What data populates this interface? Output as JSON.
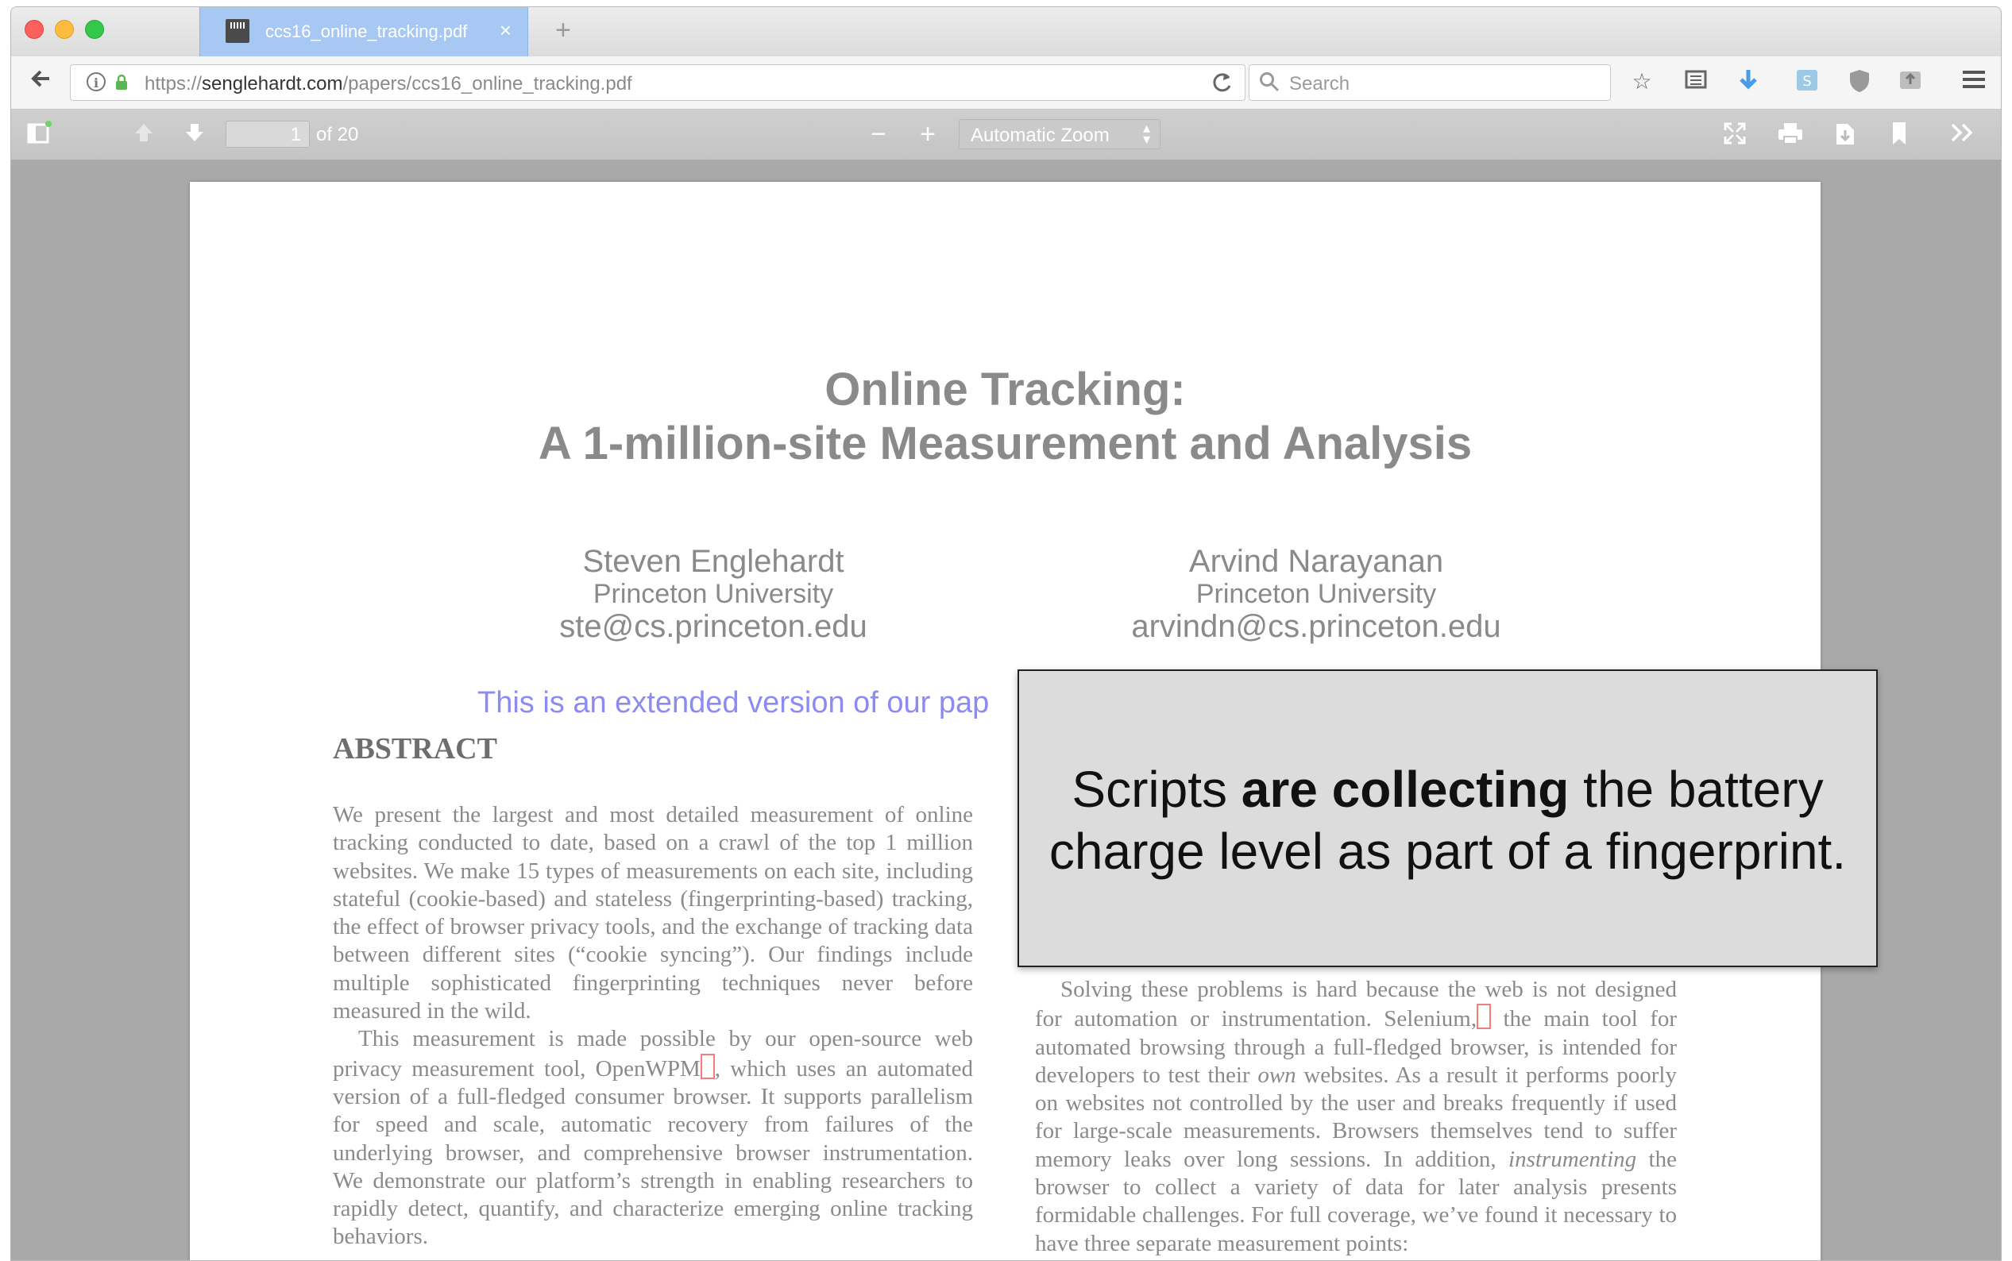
{
  "browser": {
    "tab_title": "ccs16_online_tracking.pdf",
    "tab_close": "×",
    "new_tab": "+",
    "url_scheme": "https://",
    "url_host": "senglehardt.com",
    "url_path": "/papers/ccs16_online_tracking.pdf",
    "search_placeholder": "Search"
  },
  "pdf_toolbar": {
    "page_number": "1",
    "page_count": "of 20",
    "zoom_out": "−",
    "zoom_in": "+",
    "zoom_label": "Automatic Zoom"
  },
  "paper": {
    "title_line1": "Online Tracking:",
    "title_line2": "A 1-million-site Measurement and Analysis",
    "authors": [
      {
        "name": "Steven Englehardt",
        "affiliation": "Princeton University",
        "email": "ste@cs.princeton.edu"
      },
      {
        "name": "Arvind Narayanan",
        "affiliation": "Princeton University",
        "email": "arvindn@cs.princeton.edu"
      }
    ],
    "extended_note": "This is an extended version of our pap",
    "abstract_heading": "ABSTRACT",
    "abstract_p1": "We present the largest and most detailed measurement of online tracking conducted to date, based on a crawl of the top 1 million websites. We make 15 types of measurements on each site, including stateful (cookie-based) and stateless (fingerprinting-based) tracking, the effect of browser privacy tools, and the exchange of tracking data between different sites (“cookie syncing”). Our findings include multiple sophisticated fingerprinting techniques never before measured in the wild.",
    "abstract_p2_a": "This measurement is made possible by our open-source web privacy measurement tool, OpenWPM",
    "abstract_p2_b": ", which uses an automated version of a full-fledged consumer browser. It supports parallelism for speed and scale, automatic recovery from failures of the underlying browser, and comprehensive browser instrumentation. We demonstrate our platform’s strength in enabling researchers to rapidly detect, quantify, and characterize emerging online tracking behaviors.",
    "right_col_a": "Solving these problems is hard because the web is not designed for automation or instrumentation. Selenium,",
    "right_col_b": " the main tool for automated browsing through a full-fledged browser, is intended for developers to test their ",
    "right_col_em1": "own",
    "right_col_c": " websites. As a result it performs poorly on websites not controlled by the user and breaks frequently if used for large-scale measurements. Browsers themselves tend to suffer memory leaks over long sessions. In addition, ",
    "right_col_em2": "instrumenting",
    "right_col_d": " the browser to collect a variety of data for later analysis presents formidable challenges. For full coverage, we’ve found it necessary to have three separate measurement points:"
  },
  "overlay": {
    "text_before": "Scripts ",
    "text_bold": "are collecting",
    "text_after": " the battery charge level as part of a fingerprint."
  },
  "colors": {
    "tab_active": "#a7c8f3",
    "viewer_bg": "#a9a9a9",
    "link_note": "#8b8bf2",
    "ref_box": "#f27c7c"
  }
}
